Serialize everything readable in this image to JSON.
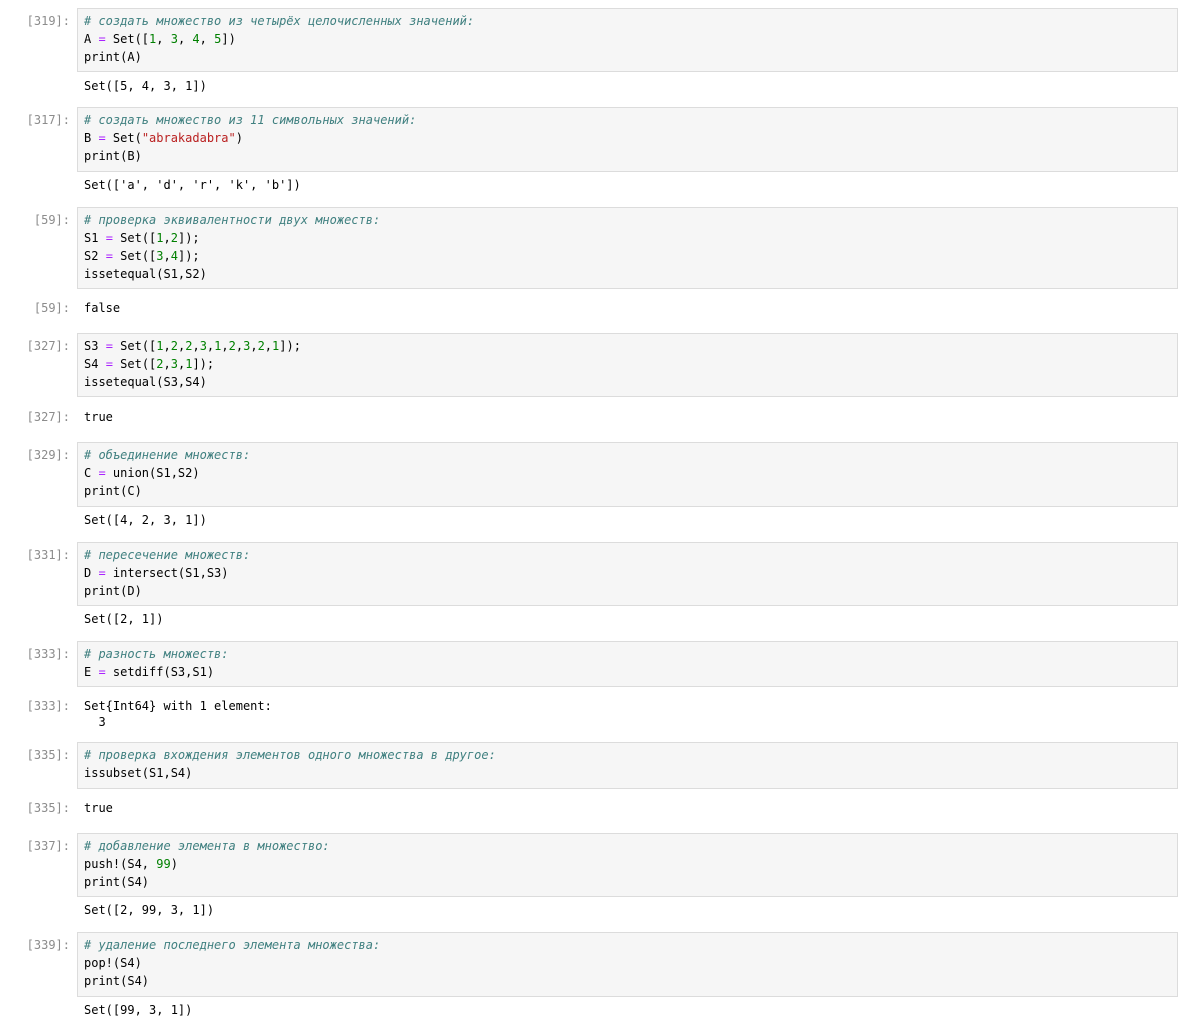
{
  "cells": [
    {
      "in_prompt": "[319]:",
      "code": [
        [
          {
            "t": "cm",
            "v": "# создать множество из четырёх целочисленных значений:"
          }
        ],
        [
          {
            "t": "tx",
            "v": "A "
          },
          {
            "t": "op",
            "v": "="
          },
          {
            "t": "tx",
            "v": " Set(["
          },
          {
            "t": "nm",
            "v": "1"
          },
          {
            "t": "tx",
            "v": ", "
          },
          {
            "t": "nm",
            "v": "3"
          },
          {
            "t": "tx",
            "v": ", "
          },
          {
            "t": "nm",
            "v": "4"
          },
          {
            "t": "tx",
            "v": ", "
          },
          {
            "t": "nm",
            "v": "5"
          },
          {
            "t": "tx",
            "v": "])"
          }
        ],
        [
          {
            "t": "tx",
            "v": "print(A)"
          }
        ]
      ],
      "out_prompt": "",
      "output": [
        "Set([5, 4, 3, 1])"
      ]
    },
    {
      "in_prompt": "[317]:",
      "code": [
        [
          {
            "t": "cm",
            "v": "# создать множество из 11 символьных значений:"
          }
        ],
        [
          {
            "t": "tx",
            "v": "B "
          },
          {
            "t": "op",
            "v": "="
          },
          {
            "t": "tx",
            "v": " Set("
          },
          {
            "t": "st",
            "v": "\"abrakadabra\""
          },
          {
            "t": "tx",
            "v": ")"
          }
        ],
        [
          {
            "t": "tx",
            "v": "print(B)"
          }
        ]
      ],
      "out_prompt": "",
      "output": [
        "Set(['a', 'd', 'r', 'k', 'b'])"
      ]
    },
    {
      "in_prompt": "[59]:",
      "code": [
        [
          {
            "t": "cm",
            "v": "# проверка эквивалентности двух множеств:"
          }
        ],
        [
          {
            "t": "tx",
            "v": "S1 "
          },
          {
            "t": "op",
            "v": "="
          },
          {
            "t": "tx",
            "v": " Set(["
          },
          {
            "t": "nm",
            "v": "1"
          },
          {
            "t": "tx",
            "v": ","
          },
          {
            "t": "nm",
            "v": "2"
          },
          {
            "t": "tx",
            "v": "]);"
          }
        ],
        [
          {
            "t": "tx",
            "v": "S2 "
          },
          {
            "t": "op",
            "v": "="
          },
          {
            "t": "tx",
            "v": " Set(["
          },
          {
            "t": "nm",
            "v": "3"
          },
          {
            "t": "tx",
            "v": ","
          },
          {
            "t": "nm",
            "v": "4"
          },
          {
            "t": "tx",
            "v": "]);"
          }
        ],
        [
          {
            "t": "tx",
            "v": "issetequal(S1,S2)"
          }
        ]
      ],
      "out_prompt": "[59]:",
      "output": [
        "false"
      ]
    },
    {
      "in_prompt": "[327]:",
      "code": [
        [
          {
            "t": "tx",
            "v": "S3 "
          },
          {
            "t": "op",
            "v": "="
          },
          {
            "t": "tx",
            "v": " Set(["
          },
          {
            "t": "nm",
            "v": "1"
          },
          {
            "t": "tx",
            "v": ","
          },
          {
            "t": "nm",
            "v": "2"
          },
          {
            "t": "tx",
            "v": ","
          },
          {
            "t": "nm",
            "v": "2"
          },
          {
            "t": "tx",
            "v": ","
          },
          {
            "t": "nm",
            "v": "3"
          },
          {
            "t": "tx",
            "v": ","
          },
          {
            "t": "nm",
            "v": "1"
          },
          {
            "t": "tx",
            "v": ","
          },
          {
            "t": "nm",
            "v": "2"
          },
          {
            "t": "tx",
            "v": ","
          },
          {
            "t": "nm",
            "v": "3"
          },
          {
            "t": "tx",
            "v": ","
          },
          {
            "t": "nm",
            "v": "2"
          },
          {
            "t": "tx",
            "v": ","
          },
          {
            "t": "nm",
            "v": "1"
          },
          {
            "t": "tx",
            "v": "]);"
          }
        ],
        [
          {
            "t": "tx",
            "v": "S4 "
          },
          {
            "t": "op",
            "v": "="
          },
          {
            "t": "tx",
            "v": " Set(["
          },
          {
            "t": "nm",
            "v": "2"
          },
          {
            "t": "tx",
            "v": ","
          },
          {
            "t": "nm",
            "v": "3"
          },
          {
            "t": "tx",
            "v": ","
          },
          {
            "t": "nm",
            "v": "1"
          },
          {
            "t": "tx",
            "v": "]);"
          }
        ],
        [
          {
            "t": "tx",
            "v": "issetequal(S3,S4)"
          }
        ]
      ],
      "out_prompt": "[327]:",
      "output": [
        "true"
      ]
    },
    {
      "in_prompt": "[329]:",
      "code": [
        [
          {
            "t": "cm",
            "v": "# объединение множеств:"
          }
        ],
        [
          {
            "t": "tx",
            "v": "C "
          },
          {
            "t": "op",
            "v": "="
          },
          {
            "t": "tx",
            "v": " union(S1,S2)"
          }
        ],
        [
          {
            "t": "tx",
            "v": "print(C)"
          }
        ]
      ],
      "out_prompt": "",
      "output": [
        "Set([4, 2, 3, 1])"
      ]
    },
    {
      "in_prompt": "[331]:",
      "code": [
        [
          {
            "t": "cm",
            "v": "# пересечение множеств:"
          }
        ],
        [
          {
            "t": "tx",
            "v": "D "
          },
          {
            "t": "op",
            "v": "="
          },
          {
            "t": "tx",
            "v": " intersect(S1,S3)"
          }
        ],
        [
          {
            "t": "tx",
            "v": "print(D)"
          }
        ]
      ],
      "out_prompt": "",
      "output": [
        "Set([2, 1])"
      ]
    },
    {
      "in_prompt": "[333]:",
      "code": [
        [
          {
            "t": "cm",
            "v": "# разность множеств:"
          }
        ],
        [
          {
            "t": "tx",
            "v": "E "
          },
          {
            "t": "op",
            "v": "="
          },
          {
            "t": "tx",
            "v": " setdiff(S3,S1)"
          }
        ]
      ],
      "out_prompt": "[333]:",
      "output": [
        "Set{Int64} with 1 element:",
        "  3"
      ]
    },
    {
      "in_prompt": "[335]:",
      "code": [
        [
          {
            "t": "cm",
            "v": "# проверка вхождения элементов одного множества в другое:"
          }
        ],
        [
          {
            "t": "tx",
            "v": "issubset(S1,S4)"
          }
        ]
      ],
      "out_prompt": "[335]:",
      "output": [
        "true"
      ]
    },
    {
      "in_prompt": "[337]:",
      "code": [
        [
          {
            "t": "cm",
            "v": "# добавление элемента в множество:"
          }
        ],
        [
          {
            "t": "tx",
            "v": "push!(S4, "
          },
          {
            "t": "nm",
            "v": "99"
          },
          {
            "t": "tx",
            "v": ")"
          }
        ],
        [
          {
            "t": "tx",
            "v": "print(S4)"
          }
        ]
      ],
      "out_prompt": "",
      "output": [
        "Set([2, 99, 3, 1])"
      ]
    },
    {
      "in_prompt": "[339]:",
      "code": [
        [
          {
            "t": "cm",
            "v": "# удаление последнего элемента множества:"
          }
        ],
        [
          {
            "t": "tx",
            "v": "pop!(S4)"
          }
        ],
        [
          {
            "t": "tx",
            "v": "print(S4)"
          }
        ]
      ],
      "out_prompt": "",
      "output": [
        "Set([99, 3, 1])"
      ]
    }
  ]
}
